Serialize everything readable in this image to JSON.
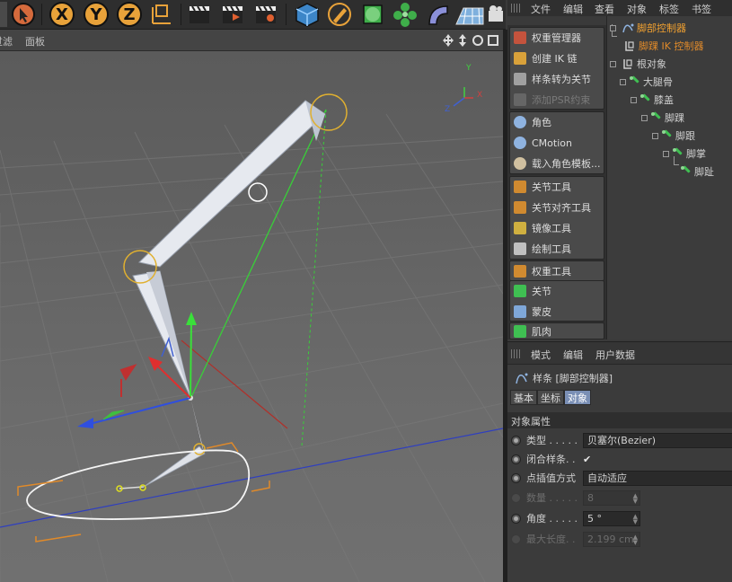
{
  "toolbar": {
    "axis_x": "X",
    "axis_y": "Y",
    "axis_z": "Z"
  },
  "viewport": {
    "menu": [
      "过滤",
      "面板"
    ],
    "axis_labels": {
      "x": "X",
      "y": "Y",
      "z": "Z"
    }
  },
  "menubar": [
    "文件",
    "编辑",
    "查看",
    "对象",
    "标签",
    "书签"
  ],
  "tools": [
    {
      "label": "权重管理器",
      "icon": "weight-manager-icon",
      "color": "#c4533d",
      "disabled": false
    },
    {
      "label": "创建 IK 链",
      "icon": "ik-chain-icon",
      "color": "#d9a13a",
      "disabled": false
    },
    {
      "label": "样条转为关节",
      "icon": "spline-to-joint-icon",
      "color": "#a0a0a0",
      "disabled": false
    },
    {
      "label": "添加PSR约束",
      "icon": "psr-constraint-icon",
      "color": "#666666",
      "disabled": true
    },
    {
      "label": "角色",
      "icon": "character-icon",
      "color": "#8fb3e0",
      "disabled": false
    },
    {
      "label": "CMotion",
      "icon": "cmotion-icon",
      "color": "#8fb3e0",
      "disabled": false
    },
    {
      "label": "载入角色模板...",
      "icon": "character-template-icon",
      "color": "#d0c0a0",
      "disabled": false
    },
    {
      "label": "关节工具",
      "icon": "joint-tool-icon",
      "color": "#d08a30",
      "disabled": false
    },
    {
      "label": "关节对齐工具",
      "icon": "joint-align-icon",
      "color": "#d08a30",
      "disabled": false
    },
    {
      "label": "镜像工具",
      "icon": "mirror-tool-icon",
      "color": "#d0b040",
      "disabled": false
    },
    {
      "label": "绘制工具",
      "icon": "paint-tool-icon",
      "color": "#c0c0c0",
      "disabled": false
    },
    {
      "label": "权重工具",
      "icon": "weight-tool-icon",
      "color": "#d08a30",
      "disabled": false
    },
    {
      "label": "关节",
      "icon": "joint-icon",
      "color": "#3fbf52",
      "disabled": false
    },
    {
      "label": "蒙皮",
      "icon": "skin-icon",
      "color": "#7fa7d8",
      "disabled": false
    },
    {
      "label": "肌肉",
      "icon": "muscle-icon",
      "color": "#3fbf52",
      "disabled": false
    }
  ],
  "object_tree": [
    {
      "label": "脚部控制器",
      "level": 0,
      "type": "spline",
      "color": "#f0a030"
    },
    {
      "label": "脚踝 IK 控制器",
      "level": 1,
      "type": "null",
      "color": "#e08a2a"
    },
    {
      "label": "根对象",
      "level": 0,
      "type": "null",
      "color": "#cfcfcf"
    },
    {
      "label": "大腿骨",
      "level": 1,
      "type": "joint",
      "color": "#cfcfcf"
    },
    {
      "label": "膝盖",
      "level": 2,
      "type": "joint",
      "color": "#cfcfcf"
    },
    {
      "label": "脚踝",
      "level": 3,
      "type": "joint",
      "color": "#cfcfcf"
    },
    {
      "label": "脚跟",
      "level": 4,
      "type": "joint",
      "color": "#cfcfcf"
    },
    {
      "label": "脚掌",
      "level": 5,
      "type": "joint",
      "color": "#cfcfcf"
    },
    {
      "label": "脚趾",
      "level": 6,
      "type": "joint",
      "color": "#cfcfcf"
    }
  ],
  "attributes": {
    "menu": [
      "模式",
      "编辑",
      "用户数据"
    ],
    "title": "样条 [脚部控制器]",
    "tabs": [
      {
        "label": "基本",
        "active": false
      },
      {
        "label": "坐标",
        "active": false
      },
      {
        "label": "对象",
        "active": true
      }
    ],
    "section": "对象属性",
    "props": [
      {
        "label": "类型 . . . . .",
        "value": "贝塞尔(Bezier)",
        "kind": "dropdown",
        "disabled": false
      },
      {
        "label": "闭合样条. .",
        "value": "✔",
        "kind": "check",
        "disabled": false
      },
      {
        "label": "点插值方式",
        "value": "自动适应",
        "kind": "dropdown",
        "disabled": false
      },
      {
        "label": "数量 . . . . .",
        "value": "8",
        "kind": "number",
        "disabled": true
      },
      {
        "label": "角度 . . . . .",
        "value": "5 °",
        "kind": "number",
        "disabled": false
      },
      {
        "label": "最大长度. .",
        "value": "2.199 cm",
        "kind": "number",
        "disabled": true
      }
    ]
  }
}
